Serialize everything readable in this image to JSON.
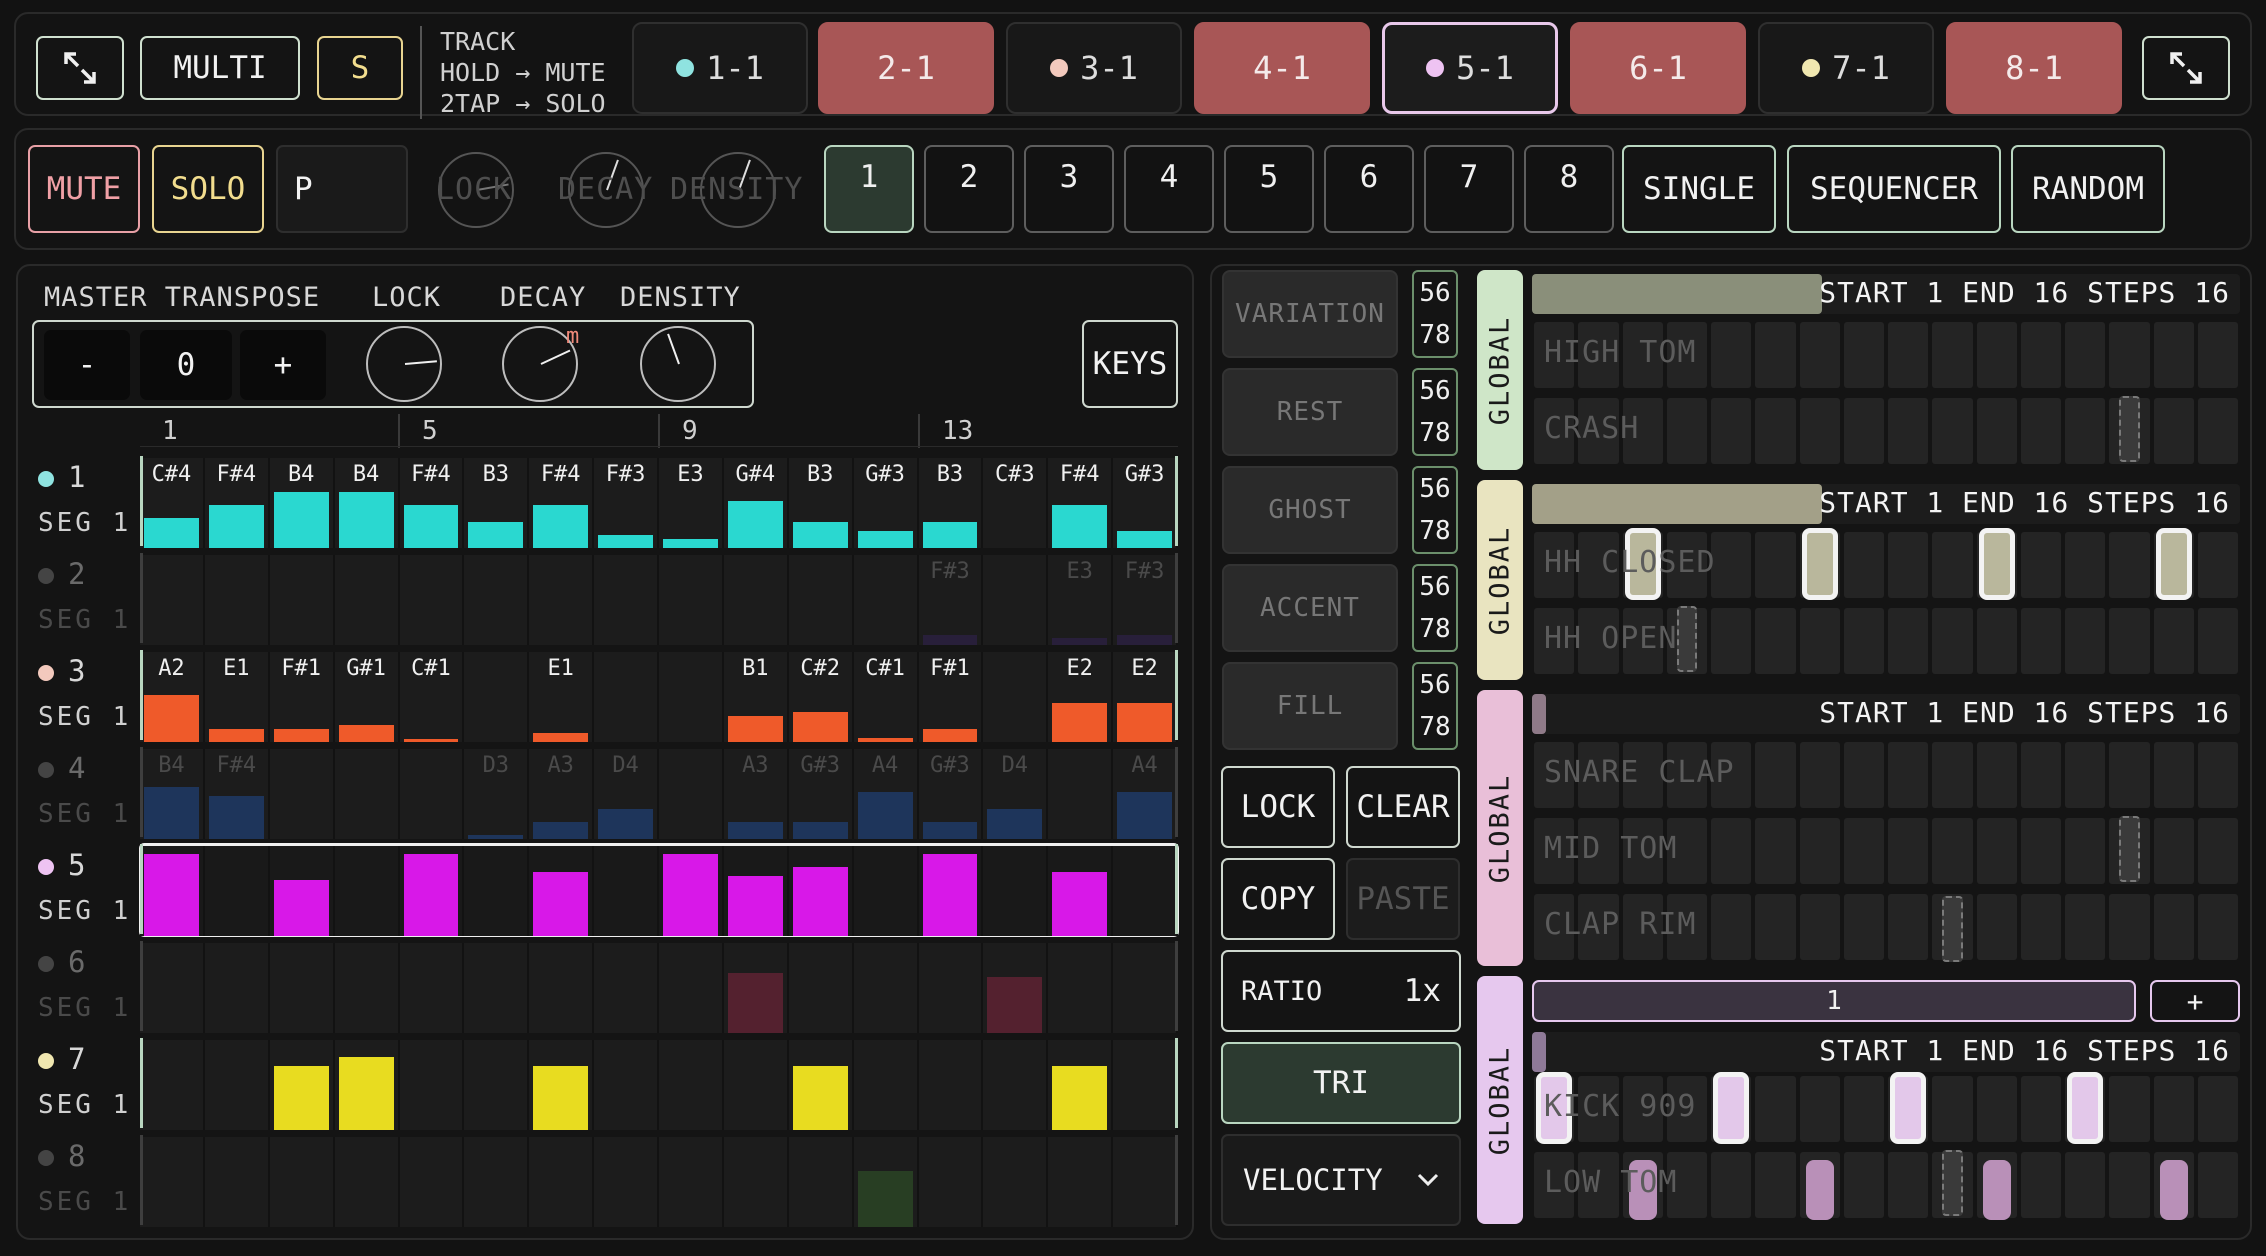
{
  "top_bar": {
    "expand_left_icon": "expand-icon",
    "multi_label": "MULTI",
    "s_label": "S",
    "track_info": [
      "TRACK",
      "HOLD → MUTE",
      "2TAP → SOLO"
    ],
    "tracks": [
      {
        "label": "1-1",
        "dot": "#8fe3e0",
        "state": "normal"
      },
      {
        "label": "2-1",
        "dot": "",
        "state": "muted"
      },
      {
        "label": "3-1",
        "dot": "#f3c9bd",
        "state": "normal"
      },
      {
        "label": "4-1",
        "dot": "",
        "state": "muted"
      },
      {
        "label": "5-1",
        "dot": "#eec3f2",
        "state": "selected"
      },
      {
        "label": "6-1",
        "dot": "",
        "state": "muted"
      },
      {
        "label": "7-1",
        "dot": "#f0e7b0",
        "state": "normal"
      },
      {
        "label": "8-1",
        "dot": "",
        "state": "muted"
      }
    ],
    "expand_right_icon": "expand-icon"
  },
  "second_bar": {
    "mute": "MUTE",
    "solo": "SOLO",
    "p_field": "P",
    "knob_labels": [
      "LOCK",
      "DECAY",
      "DENSITY"
    ],
    "numbers": [
      "1",
      "2",
      "3",
      "4",
      "5",
      "6",
      "7",
      "8"
    ],
    "selected_number": "1",
    "modes": [
      "SINGLE",
      "SEQUENCER",
      "RANDOM"
    ]
  },
  "master": {
    "labels": [
      "MASTER TRANSPOSE",
      "LOCK",
      "DECAY",
      "DENSITY"
    ],
    "minus": "-",
    "value": "0",
    "plus": "+",
    "decay_badge": "m",
    "keys": "KEYS"
  },
  "ruler": [
    "1",
    "5",
    "9",
    "13"
  ],
  "rows": [
    {
      "num": "1",
      "seg": "SEG 1",
      "dot": "#8fe3e0",
      "active": true,
      "notes": [
        "C#4",
        "F#4",
        "B4",
        "B4",
        "F#4",
        "B3",
        "F#4",
        "F#3",
        "E3",
        "G#4",
        "B3",
        "G#3",
        "B3",
        "C#3",
        "F#4",
        "G#3"
      ],
      "color": "#2ad8d0",
      "levels": [
        0.35,
        0.5,
        0.65,
        0.65,
        0.5,
        0.3,
        0.5,
        0.15,
        0.1,
        0.55,
        0.3,
        0.2,
        0.3,
        0,
        0.5,
        0.2
      ]
    },
    {
      "num": "2",
      "seg": "SEG 1",
      "dot": "#444444",
      "active": false,
      "notes": [
        "",
        "",
        "",
        "",
        "",
        "",
        "",
        "",
        "",
        "",
        "",
        "",
        "F#3",
        "",
        "E3",
        "F#3"
      ],
      "color": "#2a2040",
      "levels": [
        0,
        0,
        0,
        0,
        0,
        0,
        0,
        0,
        0,
        0,
        0,
        0,
        0.12,
        0,
        0.08,
        0.12
      ]
    },
    {
      "num": "3",
      "seg": "SEG 1",
      "dot": "#f3c9bd",
      "active": true,
      "notes": [
        "A2",
        "E1",
        "F#1",
        "G#1",
        "C#1",
        "",
        "E1",
        "",
        "",
        "B1",
        "C#2",
        "C#1",
        "F#1",
        "",
        "E2",
        "E2"
      ],
      "color": "#ef5a2a",
      "levels": [
        0.55,
        0.15,
        0.15,
        0.2,
        0.03,
        0,
        0.1,
        0,
        0,
        0.3,
        0.35,
        0.05,
        0.15,
        0,
        0.45,
        0.45
      ]
    },
    {
      "num": "4",
      "seg": "SEG 1",
      "dot": "#444444",
      "active": false,
      "notes": [
        "B4",
        "F#4",
        "",
        "",
        "",
        "D3",
        "A3",
        "D4",
        "",
        "A3",
        "G#3",
        "A4",
        "G#3",
        "D4",
        "",
        "A4"
      ],
      "color": "#1e3a66",
      "levels": [
        0.6,
        0.5,
        0,
        0,
        0,
        0.05,
        0.2,
        0.35,
        0,
        0.2,
        0.2,
        0.55,
        0.2,
        0.35,
        0,
        0.55
      ]
    },
    {
      "num": "5",
      "seg": "SEG 1",
      "dot": "#eec3f2",
      "active": true,
      "notes": [
        "",
        "",
        "",
        "",
        "",
        "",
        "",
        "",
        "",
        "",
        "",
        "",
        "",
        "",
        "",
        ""
      ],
      "color": "#d818e8",
      "levels": [
        0.95,
        0,
        0.65,
        0,
        0.95,
        0,
        0.75,
        0,
        0.95,
        0.7,
        0.8,
        0,
        0.95,
        0,
        0.75,
        0
      ]
    },
    {
      "num": "6",
      "seg": "SEG 1",
      "dot": "#444444",
      "active": false,
      "notes": [
        "",
        "",
        "",
        "",
        "",
        "",
        "",
        "",
        "",
        "",
        "",
        "",
        "",
        "",
        "",
        ""
      ],
      "color": "#5e2232",
      "levels": [
        0,
        0,
        0,
        0,
        0,
        0,
        0,
        0,
        0,
        0.7,
        0,
        0,
        0,
        0.65,
        0,
        0
      ]
    },
    {
      "num": "7",
      "seg": "SEG 1",
      "dot": "#f0e7b0",
      "active": true,
      "notes": [
        "",
        "",
        "",
        "",
        "",
        "",
        "",
        "",
        "",
        "",
        "",
        "",
        "",
        "",
        "",
        ""
      ],
      "color": "#e8dc20",
      "levels": [
        0,
        0,
        0.75,
        0.85,
        0,
        0,
        0.75,
        0,
        0,
        0,
        0.75,
        0,
        0,
        0,
        0.75,
        0
      ]
    },
    {
      "num": "8",
      "seg": "SEG 1",
      "dot": "#444444",
      "active": false,
      "notes": [
        "",
        "",
        "",
        "",
        "",
        "",
        "",
        "",
        "",
        "",
        "",
        "",
        "",
        "",
        "",
        ""
      ],
      "color": "#2a4424",
      "levels": [
        0,
        0,
        0,
        0,
        0,
        0,
        0,
        0,
        0,
        0,
        0,
        0.65,
        0,
        0,
        0,
        0
      ]
    }
  ],
  "side": {
    "variation": "VARIATION",
    "rest": "REST",
    "ghost": "GHOST",
    "accent": "ACCENT",
    "fill": "FILL",
    "mini": [
      "5",
      "6",
      "7",
      "8"
    ],
    "lock": "LOCK",
    "clear": "CLEAR",
    "copy": "COPY",
    "paste": "PASTE",
    "ratio_label": "RATIO",
    "ratio_value": "1x",
    "tri": "TRI",
    "velocity": "VELOCITY"
  },
  "global_label": "GLOBAL",
  "seq_header": "START 1 END 16 STEPS 16",
  "drum_groups": [
    {
      "color": "#cfe6c8",
      "fill": "#8a8f7a",
      "labels": [
        "HIGH TOM",
        "CRASH"
      ]
    },
    {
      "color": "#e9e4c0",
      "fill": "#a3a088",
      "labels": [
        "HH CLOSED",
        "HH OPEN"
      ]
    },
    {
      "color": "#e9bfd8",
      "fill": "#8f7a88",
      "labels": [
        "SNARE CLAP",
        "MID TOM",
        "CLAP RIM"
      ]
    },
    {
      "color": "#e6c8ee",
      "fill": "#8f7a98",
      "labels": [
        "KICK 909",
        "LOW TOM"
      ],
      "page": "1",
      "page_add": "+"
    }
  ]
}
